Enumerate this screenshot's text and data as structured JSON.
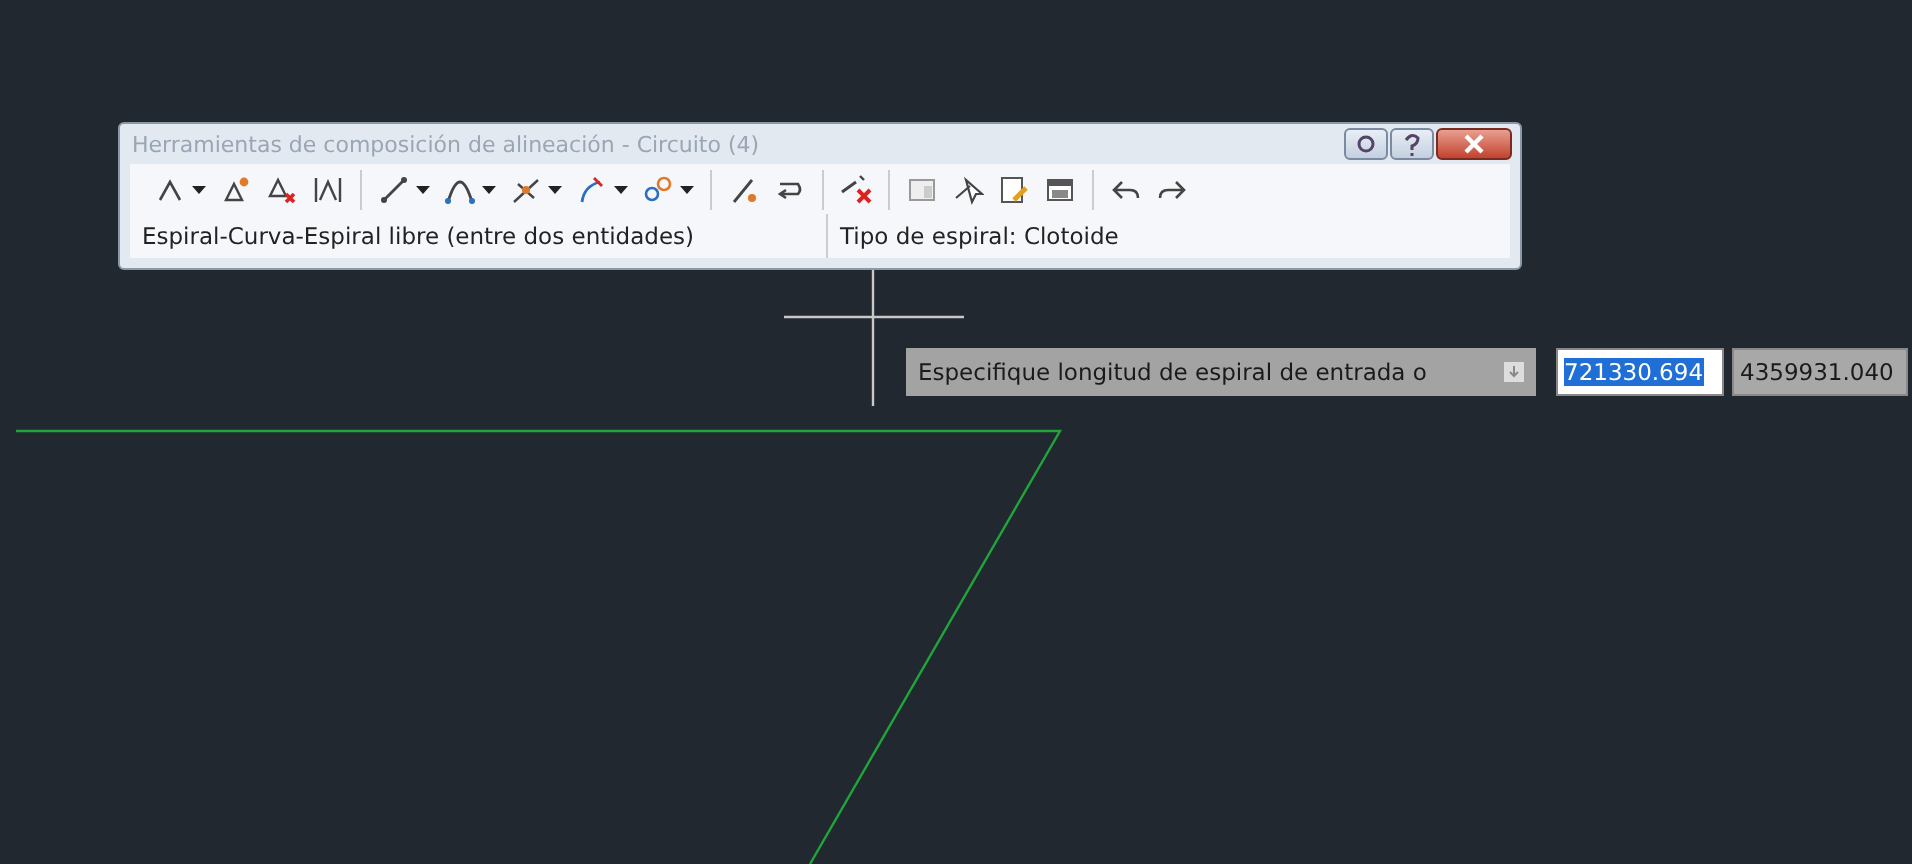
{
  "window": {
    "title": "Herramientas de composición de alineación - Circuito (4)"
  },
  "toolbar": {
    "groups": [
      {
        "items": [
          {
            "dropdown": true
          },
          {
            "dropdown": false
          },
          {
            "dropdown": false
          },
          {
            "dropdown": false
          }
        ]
      },
      {
        "items": [
          {
            "dropdown": true
          },
          {
            "dropdown": true
          },
          {
            "dropdown": true
          },
          {
            "dropdown": true
          },
          {
            "dropdown": true
          }
        ]
      },
      {
        "items": [
          {
            "dropdown": false
          },
          {
            "dropdown": false
          }
        ]
      },
      {
        "items": [
          {
            "dropdown": false
          }
        ]
      },
      {
        "items": [
          {
            "dropdown": false
          },
          {
            "dropdown": false
          },
          {
            "dropdown": false
          },
          {
            "dropdown": false
          }
        ]
      },
      {
        "items": [
          {
            "dropdown": false
          },
          {
            "dropdown": false
          }
        ]
      }
    ]
  },
  "status_bar": [
    "Espiral-Curva-Espiral libre (entre dos entidades)",
    "Tipo de espiral: Clotoide"
  ],
  "prompt": {
    "text": "Especifique longitud de espiral de entrada o",
    "fields": [
      {
        "value": "721330.694",
        "selected": true
      },
      {
        "value": "4359931.040",
        "selected": false
      }
    ]
  }
}
